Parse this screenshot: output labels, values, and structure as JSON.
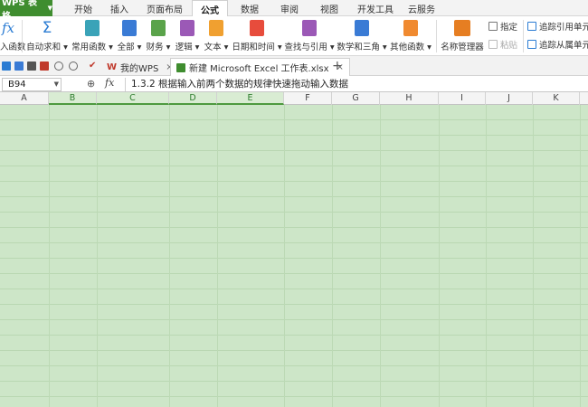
{
  "menubar": {
    "app_name": "WPS 表格",
    "tabs": [
      "开始",
      "插入",
      "页面布局",
      "公式",
      "数据",
      "审阅",
      "视图",
      "开发工具",
      "云服务"
    ],
    "active_tab": "公式"
  },
  "ribbon": {
    "buttons": [
      {
        "label": "入函数",
        "icon": "fx-icon",
        "color": "#2b7cd3"
      },
      {
        "label": "自动求和 ▾",
        "icon": "sigma-icon",
        "color": "#2b7cd3"
      },
      {
        "label": "常用函数 ▾",
        "icon": "star-book-icon",
        "color": "#3aa3b8"
      },
      {
        "label": "全部 ▾",
        "icon": "list-book-icon",
        "color": "#3a7bd5"
      },
      {
        "label": "财务 ▾",
        "icon": "money-book-icon",
        "color": "#5aa34a"
      },
      {
        "label": "逻辑 ▾",
        "icon": "question-book-icon",
        "color": "#9b59b6"
      },
      {
        "label": "文本 ▾",
        "icon": "text-book-icon",
        "color": "#f0a030"
      },
      {
        "label": "日期和时间 ▾",
        "icon": "clock-book-icon",
        "color": "#e74c3c"
      },
      {
        "label": "查找与引用 ▾",
        "icon": "search-book-icon",
        "color": "#9b59b6"
      },
      {
        "label": "数学和三角 ▾",
        "icon": "theta-book-icon",
        "color": "#3a7bd5"
      },
      {
        "label": "其他函数 ▾",
        "icon": "more-book-icon",
        "color": "#f08a30"
      },
      {
        "label": "名称管理器",
        "icon": "name-manager-icon",
        "color": "#e67e22"
      }
    ],
    "small": {
      "specify": "指定",
      "paste": "粘贴",
      "trace_precedents": "追踪引用单元",
      "trace_dependents": "追踪从属单元"
    }
  },
  "quickbar": {
    "tabs": [
      {
        "label": "我的WPS",
        "close": "×"
      },
      {
        "label": "新建 Microsoft Excel 工作表.xlsx",
        "close": "×"
      }
    ],
    "new_tab": "+"
  },
  "formula_bar": {
    "cell_ref": "B94",
    "fx_label": "fx",
    "content": "1.3.2 根据输入前两个数据的规律快速拖动输入数据"
  },
  "grid": {
    "columns": [
      "A",
      "B",
      "C",
      "D",
      "E",
      "F",
      "G",
      "H",
      "I",
      "J",
      "K"
    ],
    "selected_columns": [
      "B",
      "C",
      "D",
      "E"
    ],
    "sheet_color": "#cde6c8"
  }
}
